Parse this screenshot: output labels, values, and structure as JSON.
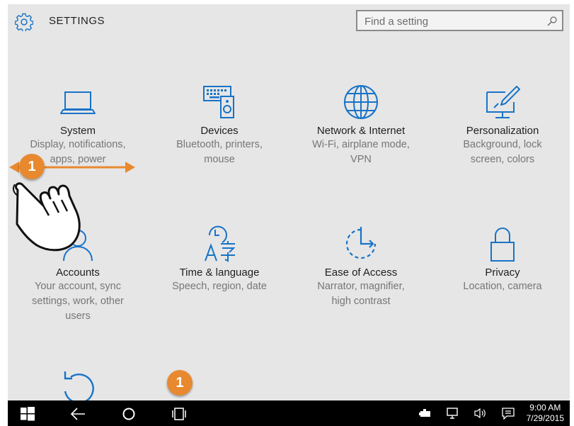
{
  "app": {
    "title": "SETTINGS",
    "search_placeholder": "Find a setting",
    "accent": "#1873c7"
  },
  "tiles": [
    {
      "name": "System",
      "desc1": "Display, notifications,",
      "desc2": "apps, power",
      "desc3": "",
      "icon": "laptop-icon"
    },
    {
      "name": "Devices",
      "desc1": "Bluetooth, printers,",
      "desc2": "mouse",
      "desc3": "",
      "icon": "devices-icon"
    },
    {
      "name": "Network & Internet",
      "desc1": "Wi-Fi, airplane mode,",
      "desc2": "VPN",
      "desc3": "",
      "icon": "globe-icon"
    },
    {
      "name": "Personalization",
      "desc1": "Background, lock",
      "desc2": "screen, colors",
      "desc3": "",
      "icon": "personalization-icon"
    },
    {
      "name": "Accounts",
      "desc1": "Your account, sync",
      "desc2": "settings, work, other",
      "desc3": "users",
      "icon": "person-icon"
    },
    {
      "name": "Time & language",
      "desc1": "Speech, region, date",
      "desc2": "",
      "desc3": "",
      "icon": "time-language-icon"
    },
    {
      "name": "Ease of Access",
      "desc1": "Narrator, magnifier,",
      "desc2": "high contrast",
      "desc3": "",
      "icon": "ease-of-access-icon"
    },
    {
      "name": "Privacy",
      "desc1": "Location, camera",
      "desc2": "",
      "desc3": "",
      "icon": "lock-icon"
    }
  ],
  "partial_tile": {
    "icon": "update-icon"
  },
  "taskbar": {
    "time": "9:00 AM",
    "date": "7/29/2015"
  },
  "annotations": {
    "callout_label": "1",
    "callout_color": "#e8892f"
  }
}
